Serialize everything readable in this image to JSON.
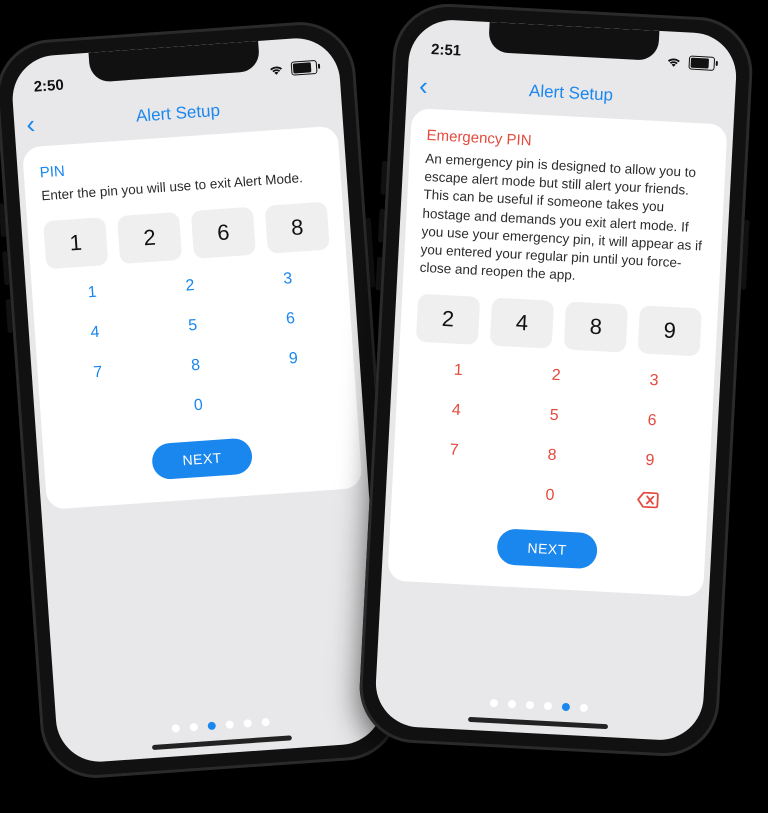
{
  "left": {
    "status_time": "2:50",
    "nav_title": "Alert Setup",
    "heading": "PIN",
    "description": "Enter the pin you will use to exit Alert Mode.",
    "pin_values": [
      "1",
      "2",
      "6",
      "8"
    ],
    "keypad": [
      "1",
      "2",
      "3",
      "4",
      "5",
      "6",
      "7",
      "8",
      "9",
      "",
      "0",
      ""
    ],
    "next_label": "NEXT",
    "dots_total": 6,
    "dots_active_index": 2
  },
  "right": {
    "status_time": "2:51",
    "nav_title": "Alert Setup",
    "heading": "Emergency PIN",
    "description": "An emergency pin is designed to allow you to escape alert mode but still alert your friends. This can be useful if someone takes you hostage and demands you exit alert mode. If you use your emergency pin, it will appear as if you entered your regular pin until you force-close and reopen the app.",
    "pin_values": [
      "2",
      "4",
      "8",
      "9"
    ],
    "keypad": [
      "1",
      "2",
      "3",
      "4",
      "5",
      "6",
      "7",
      "8",
      "9",
      "",
      "0",
      "⌫"
    ],
    "next_label": "NEXT",
    "dots_total": 6,
    "dots_active_index": 4
  },
  "colors": {
    "accent_blue": "#1a87ef",
    "accent_red": "#e44a3d"
  }
}
